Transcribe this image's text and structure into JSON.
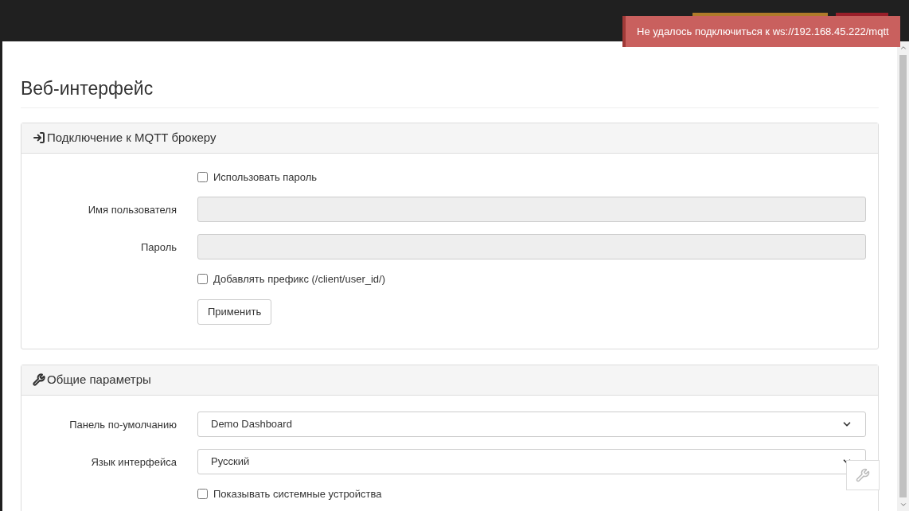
{
  "toast": {
    "message": "Не удалось подключиться к ws://192.168.45.222/mqtt"
  },
  "page": {
    "title": "Веб-интерфейс"
  },
  "panels": [
    {
      "title": "Подключение к MQTT брокеру",
      "rows": [
        {
          "kind": "checkbox",
          "label": "Использовать пароль",
          "checked": false
        },
        {
          "kind": "text",
          "label": "Имя пользователя",
          "value": "",
          "disabled": true
        },
        {
          "kind": "text",
          "label": "Пароль",
          "value": "",
          "disabled": true
        },
        {
          "kind": "checkbox",
          "label": "Добавлять префикс (/client/user_id/)",
          "checked": false
        },
        {
          "kind": "button",
          "label": "Применить"
        }
      ]
    },
    {
      "title": "Общие параметры",
      "rows": [
        {
          "kind": "select",
          "label": "Панель по-умолчанию",
          "value": "Demo Dashboard"
        },
        {
          "kind": "select",
          "label": "Язык интерфейса",
          "value": "Русский"
        },
        {
          "kind": "checkbox",
          "label": "Показывать системные устройства",
          "checked": false
        }
      ]
    }
  ]
}
